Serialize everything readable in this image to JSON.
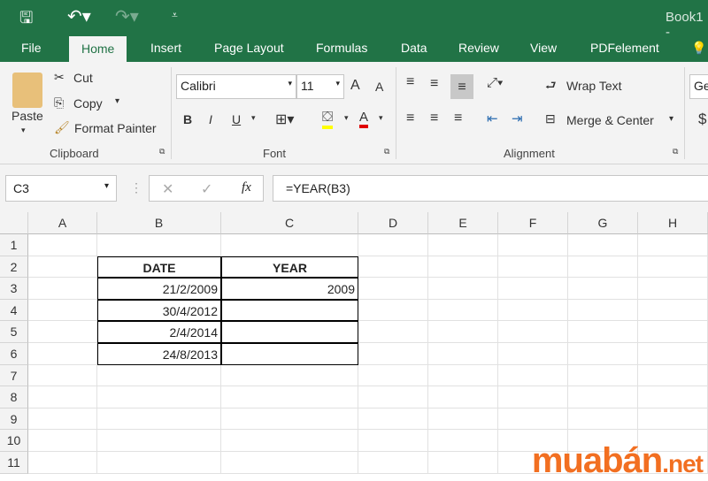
{
  "title_bar": {
    "title": "Book1 -",
    "icons": [
      "save-icon",
      "undo-icon",
      "redo-icon",
      "customize-icon"
    ]
  },
  "tabs": [
    "File",
    "Home",
    "Insert",
    "Page Layout",
    "Formulas",
    "Data",
    "Review",
    "View",
    "PDFelement"
  ],
  "active_tab": "Home",
  "clipboard": {
    "paste": "Paste",
    "cut": "Cut",
    "copy": "Copy",
    "format_painter": "Format Painter",
    "label": "Clipboard"
  },
  "font": {
    "name": "Calibri",
    "size": "11",
    "bold": "B",
    "italic": "I",
    "underline": "U",
    "label": "Font",
    "grow": "A",
    "shrink": "A",
    "font_color": "A",
    "highlight_color": "#ffff00",
    "font_color_hex": "#e00000"
  },
  "alignment": {
    "wrap_text": "Wrap Text",
    "merge_center": "Merge & Center",
    "label": "Alignment"
  },
  "number": {
    "format": "Ge",
    "currency": "$"
  },
  "formula_bar": {
    "name_box": "C3",
    "formula": "=YEAR(B3)",
    "fx": "fx"
  },
  "columns": [
    "A",
    "B",
    "C",
    "D",
    "E",
    "F",
    "G",
    "H"
  ],
  "rows": [
    "1",
    "2",
    "3",
    "4",
    "5",
    "6",
    "7",
    "8",
    "9",
    "10",
    "11"
  ],
  "table": {
    "headers": [
      "DATE",
      "YEAR"
    ],
    "rows": [
      [
        "21/2/2009",
        "2009"
      ],
      [
        "30/4/2012",
        ""
      ],
      [
        "2/4/2014",
        ""
      ],
      [
        "24/8/2013",
        ""
      ]
    ]
  },
  "watermark": {
    "text": "muabán",
    "suffix": ".net",
    "color": "#f26f21"
  },
  "colors": {
    "excel_green": "#217346"
  }
}
